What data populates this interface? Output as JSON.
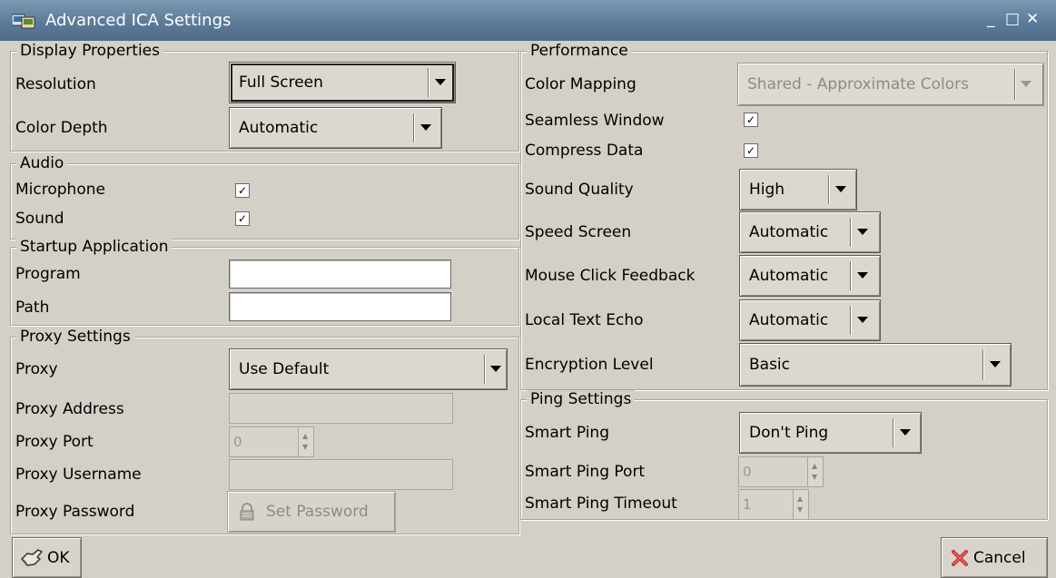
{
  "window": {
    "title": "Advanced ICA Settings",
    "controls": {
      "minimize": "_",
      "maximize": "□",
      "close": "✕"
    }
  },
  "display": {
    "legend": "Display Properties",
    "resolution_label": "Resolution",
    "resolution_value": "Full Screen",
    "color_depth_label": "Color Depth",
    "color_depth_value": "Automatic"
  },
  "audio": {
    "legend": "Audio",
    "microphone_label": "Microphone",
    "microphone_checked": true,
    "sound_label": "Sound",
    "sound_checked": true
  },
  "startup": {
    "legend": "Startup Application",
    "program_label": "Program",
    "program_value": "",
    "path_label": "Path",
    "path_value": ""
  },
  "proxy": {
    "legend": "Proxy Settings",
    "proxy_label": "Proxy",
    "proxy_value": "Use Default",
    "address_label": "Proxy Address",
    "address_value": "",
    "port_label": "Proxy Port",
    "port_value": "0",
    "username_label": "Proxy Username",
    "username_value": "",
    "password_label": "Proxy Password",
    "set_password_label": "Set Password"
  },
  "performance": {
    "legend": "Performance",
    "color_mapping_label": "Color Mapping",
    "color_mapping_value": "Shared - Approximate Colors",
    "seamless_label": "Seamless Window",
    "seamless_checked": true,
    "compress_label": "Compress Data",
    "compress_checked": true,
    "sound_quality_label": "Sound Quality",
    "sound_quality_value": "High",
    "speed_screen_label": "Speed Screen",
    "speed_screen_value": "Automatic",
    "mouse_feedback_label": "Mouse Click Feedback",
    "mouse_feedback_value": "Automatic",
    "text_echo_label": "Local Text Echo",
    "text_echo_value": "Automatic",
    "encryption_label": "Encryption Level",
    "encryption_value": "Basic"
  },
  "ping": {
    "legend": "Ping Settings",
    "smart_ping_label": "Smart Ping",
    "smart_ping_value": "Don't Ping",
    "port_label": "Smart Ping Port",
    "port_value": "0",
    "timeout_label": "Smart Ping Timeout",
    "timeout_value": "1"
  },
  "buttons": {
    "ok_label": "OK",
    "cancel_label": "Cancel"
  },
  "colors": {
    "titlebar": "#5d7b98",
    "background": "#d4d0c8"
  },
  "icons": [
    "app-icon",
    "dropdown-arrow-icon",
    "checkmark-icon",
    "lock-icon",
    "ok-hand-icon",
    "cancel-x-icon",
    "minimize-icon",
    "maximize-icon",
    "close-icon"
  ]
}
